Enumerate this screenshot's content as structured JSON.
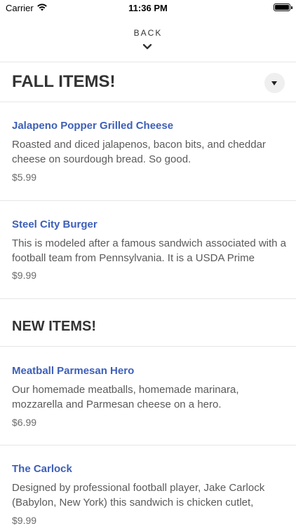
{
  "status_bar": {
    "carrier": "Carrier",
    "time": "11:36 PM"
  },
  "nav": {
    "back_label": "BACK"
  },
  "sections": [
    {
      "title": "FALL ITEMS!",
      "items": [
        {
          "name": "Jalapeno Popper Grilled Cheese",
          "description": "Roasted and diced jalapenos, bacon bits, and cheddar cheese on sourdough bread. So good.",
          "price": "$5.99"
        },
        {
          "name": "Steel City Burger",
          "description": "This is modeled after a famous sandwich associated with a football team from Pennsylvania.  It is a USDA Prime",
          "price": "$9.99"
        }
      ]
    },
    {
      "title": "NEW ITEMS!",
      "items": [
        {
          "name": "Meatball Parmesan Hero",
          "description": "Our homemade meatballs, homemade marinara, mozzarella and Parmesan cheese on a hero.",
          "price": "$6.99"
        },
        {
          "name": "The Carlock",
          "description": "Designed by professional football player, Jake Carlock (Babylon, New York) this sandwich is chicken cutlet,",
          "price": "$9.99"
        }
      ]
    }
  ]
}
